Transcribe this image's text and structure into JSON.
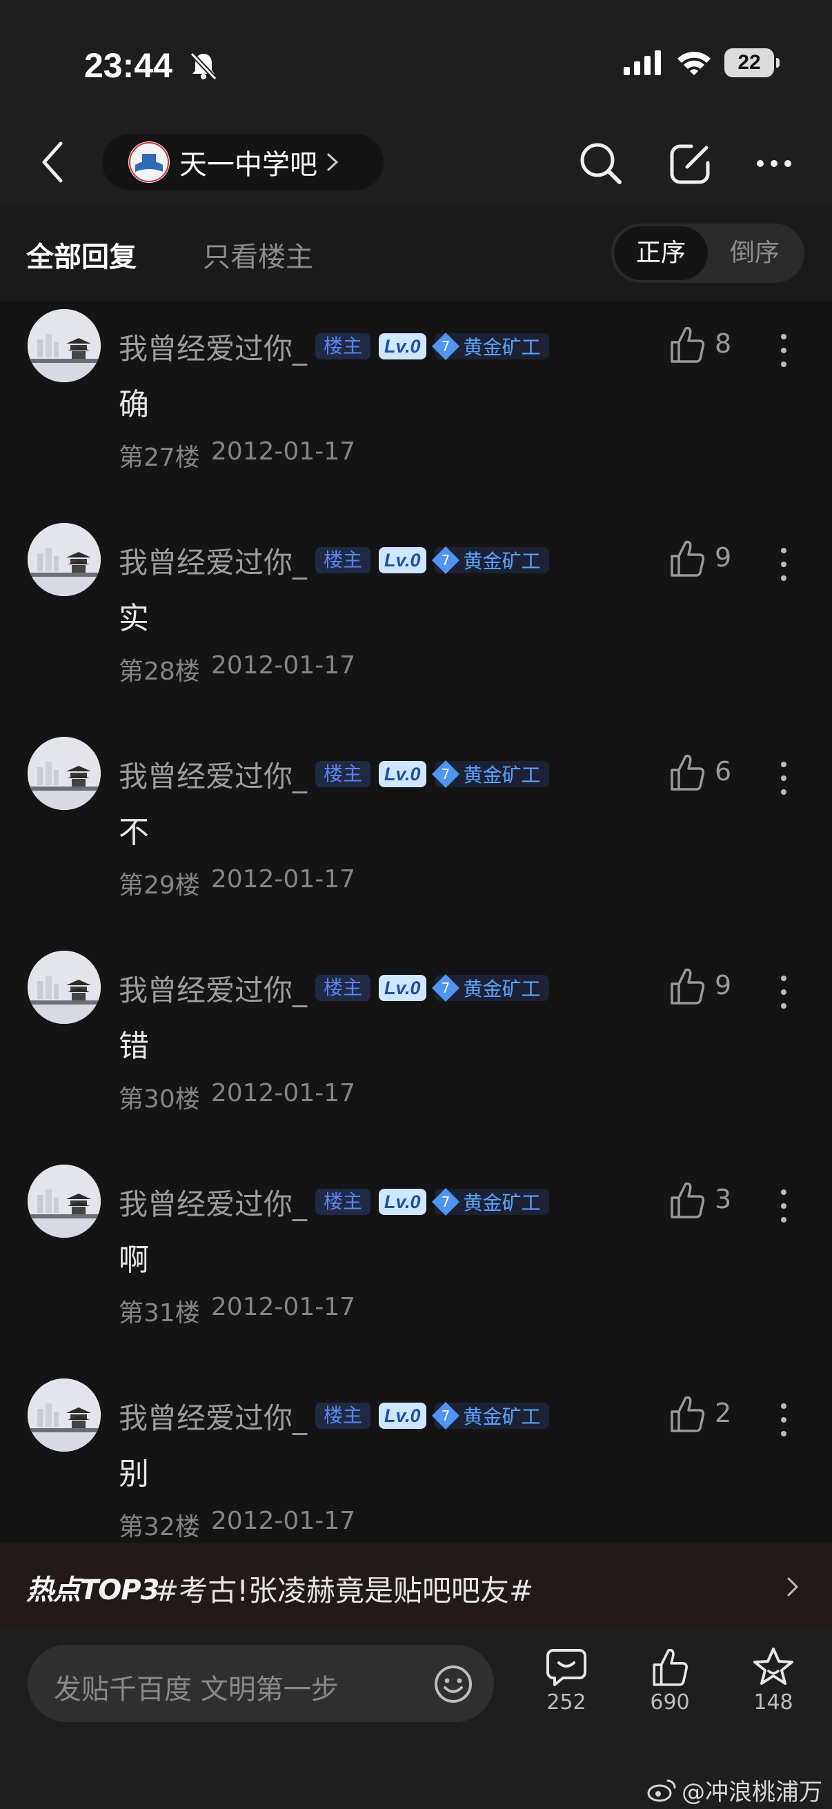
{
  "status_bar": {
    "time": "23:44",
    "battery": "22"
  },
  "header": {
    "forum_name": "天一中学吧"
  },
  "tabs": {
    "all_replies": "全部回复",
    "op_only": "只看楼主"
  },
  "order": {
    "ascending": "正序",
    "descending": "倒序"
  },
  "badges": {
    "op": "楼主",
    "level": "Lv.0",
    "rank_num": "7",
    "rank_title": "黄金矿工"
  },
  "replies": [
    {
      "username": "我曾经爱过你_",
      "text": "确",
      "floor": "第27楼",
      "date": "2012-01-17",
      "likes": "8"
    },
    {
      "username": "我曾经爱过你_",
      "text": "实",
      "floor": "第28楼",
      "date": "2012-01-17",
      "likes": "9"
    },
    {
      "username": "我曾经爱过你_",
      "text": "不",
      "floor": "第29楼",
      "date": "2012-01-17",
      "likes": "6"
    },
    {
      "username": "我曾经爱过你_",
      "text": "错",
      "floor": "第30楼",
      "date": "2012-01-17",
      "likes": "9"
    },
    {
      "username": "我曾经爱过你_",
      "text": "啊",
      "floor": "第31楼",
      "date": "2012-01-17",
      "likes": "3"
    },
    {
      "username": "我曾经爱过你_",
      "text": "别",
      "floor": "第32楼",
      "date": "2012-01-17",
      "likes": "2"
    }
  ],
  "hot_topic": {
    "label": "热点TOP3",
    "topic": "#考古!张凌赫竟是贴吧吧友#"
  },
  "composer": {
    "placeholder": "发贴千百度 文明第一步"
  },
  "actions": {
    "comments": "252",
    "likes": "690",
    "favorites": "148"
  },
  "watermark": "@冲浪桃浦万",
  "colors": {
    "background": "#141414",
    "accent_blue": "#5aa3ff",
    "op_badge": "#5d85f0"
  }
}
